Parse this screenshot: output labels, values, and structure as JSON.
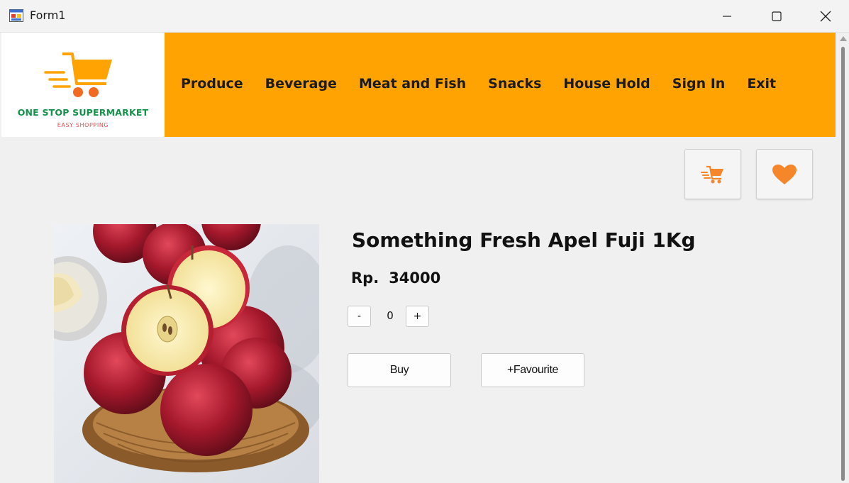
{
  "window": {
    "title": "Form1"
  },
  "logo": {
    "name": "ONE STOP SUPERMARKET",
    "tagline": "EASY SHOPPING",
    "color_name": "#15924a",
    "color_cart": "#fea301"
  },
  "nav": {
    "items": [
      "Produce",
      "Beverage",
      "Meat and Fish",
      "Snacks",
      "House Hold",
      "Sign In",
      "Exit"
    ]
  },
  "colors": {
    "header": "#fea301",
    "accent_icon": "#f5862a",
    "background": "#f0f0f0"
  },
  "icons": {
    "cart": "shopping-cart-icon",
    "favourite": "heart-icon"
  },
  "product": {
    "title": "Something Fresh Apel Fuji 1Kg",
    "currency": "Rp.",
    "price": "34000",
    "quantity": "0",
    "minus_label": "-",
    "plus_label": "+",
    "buy_label": "Buy",
    "favourite_label": "+Favourite"
  }
}
